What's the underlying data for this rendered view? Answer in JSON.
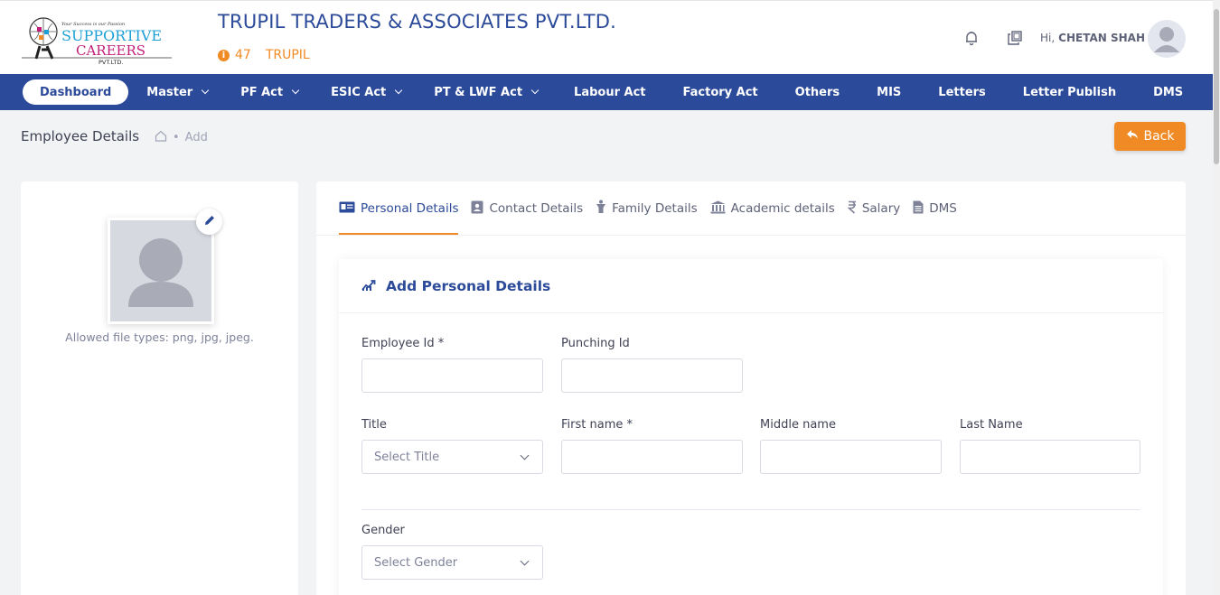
{
  "header": {
    "logo": {
      "tagline": "Your Success is our Passion",
      "line1": "SUPPORTIVE",
      "line2": "CAREERS",
      "line3": "PVT.LTD."
    },
    "company_name": "TRUPIL TRADERS & ASSOCIATES PVT.LTD.",
    "company_number": "47",
    "company_code": "TRUPIL",
    "greeting_prefix": "Hi,",
    "user_name": "CHETAN SHAH"
  },
  "nav": {
    "items": [
      {
        "label": "Dashboard"
      },
      {
        "label": "Master"
      },
      {
        "label": "PF Act"
      },
      {
        "label": "ESIC Act"
      },
      {
        "label": "PT & LWF Act"
      },
      {
        "label": "Labour Act"
      },
      {
        "label": "Factory Act"
      },
      {
        "label": "Others"
      },
      {
        "label": "MIS"
      },
      {
        "label": "Letters"
      },
      {
        "label": "Letter Publish"
      },
      {
        "label": "DMS"
      }
    ]
  },
  "subheader": {
    "title": "Employee Details",
    "crumb": "Add",
    "back_label": "Back"
  },
  "profile": {
    "allowed_types": "Allowed file types: png, jpg, jpeg."
  },
  "tabs": [
    {
      "label": "Personal Details"
    },
    {
      "label": "Contact Details"
    },
    {
      "label": "Family Details"
    },
    {
      "label": "Academic details"
    },
    {
      "label": "Salary"
    },
    {
      "label": "DMS"
    }
  ],
  "form": {
    "heading": "Add Personal Details",
    "employee_id_label": "Employee Id *",
    "punching_id_label": "Punching Id",
    "title_label": "Title",
    "title_placeholder": "Select Title",
    "first_name_label": "First name *",
    "middle_name_label": "Middle name",
    "last_name_label": "Last Name",
    "gender_label": "Gender",
    "gender_placeholder": "Select Gender"
  },
  "colors": {
    "primary": "#2c4a9a",
    "accent": "#f08a24"
  }
}
